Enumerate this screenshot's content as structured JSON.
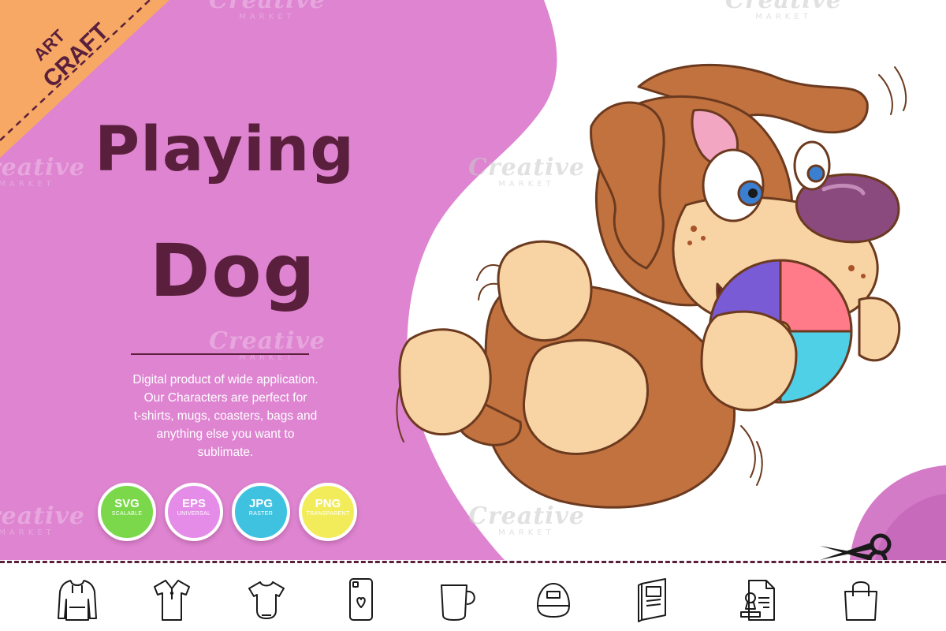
{
  "corner_badge": {
    "line1": "ART",
    "line2": "CRAFT"
  },
  "title": {
    "line1": "Playing",
    "line2": "Dog"
  },
  "description": [
    "Digital product of wide application.",
    "Our Characters are perfect for",
    "t-shirts, mugs, coasters, bags and",
    "anything else you want to",
    "sublimate."
  ],
  "formats": [
    {
      "label": "SVG",
      "sub": "SCALABLE",
      "color": "#7ad84a"
    },
    {
      "label": "EPS",
      "sub": "UNIVERSAL",
      "color": "#e58ce8"
    },
    {
      "label": "JPG",
      "sub": "RASTER",
      "color": "#3fc2e0"
    },
    {
      "label": "PNG",
      "sub": "TRANSPARENT",
      "color": "#f3ec5a"
    }
  ],
  "watermark": {
    "word": "Creative",
    "sub": "MARKET"
  },
  "product_icons": [
    "hoodie-icon",
    "polo-shirt-icon",
    "baby-bodysuit-icon",
    "phone-case-icon",
    "mug-icon",
    "cap-icon",
    "book-icon",
    "stamp-document-icon",
    "shopping-bag-icon"
  ],
  "colors": {
    "background_pink": "#de84d1",
    "dark_text": "#5a1f3c",
    "corner_orange": "#f7a865",
    "dog_brown": "#c2723f",
    "dog_cream": "#f8d3a3",
    "nose_purple": "#8a4a7e"
  }
}
